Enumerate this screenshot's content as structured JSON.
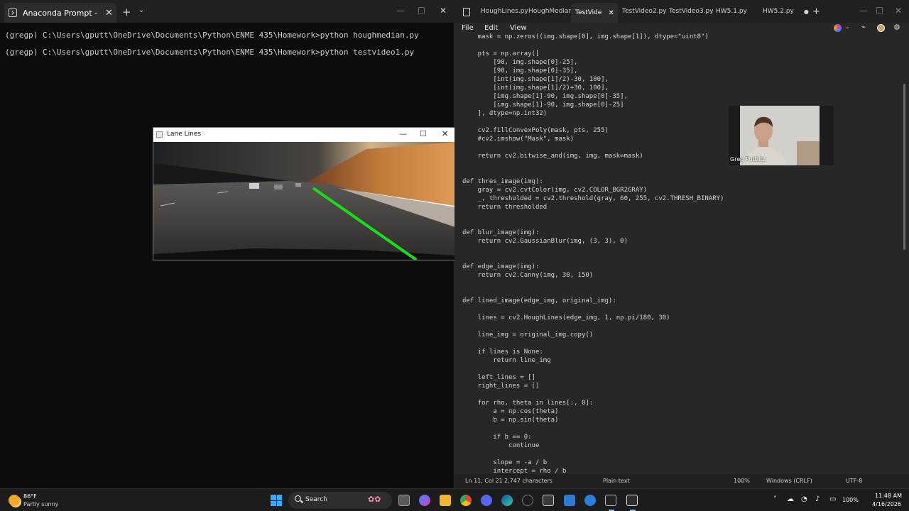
{
  "terminal": {
    "tab_title": "Anaconda Prompt - python t",
    "new_tab": "+",
    "lines": [
      "(gregp) C:\\Users\\gputt\\OneDrive\\Documents\\Python\\ENME 435\\Homework>python houghmedian.py",
      "(gregp) C:\\Users\\gputt\\OneDrive\\Documents\\Python\\ENME 435\\Homework>python testvideo1.py"
    ]
  },
  "lane_window": {
    "title": "Lane Lines"
  },
  "editor": {
    "tabs": [
      "HoughLines.py",
      "HoughMedian.p",
      "TestVide",
      "TestVideo2.py",
      "TestVideo3.py",
      "HW5.1.py",
      "HW5.2.py"
    ],
    "active_tab_index": 2,
    "menu": [
      "File",
      "Edit",
      "View"
    ],
    "code": [
      "    mask = np.zeros((img.shape[0], img.shape[1]), dtype=\"uint8\")",
      "",
      "    pts = np.array([",
      "        [90, img.shape[0]-25],",
      "        [90, img.shape[0]-35],",
      "        [int(img.shape[1]/2)-30, 100],",
      "        [int(img.shape[1]/2)+30, 100],",
      "        [img.shape[1]-90, img.shape[0]-35],",
      "        [img.shape[1]-90, img.shape[0]-25]",
      "    ], dtype=np.int32)",
      "",
      "    cv2.fillConvexPoly(mask, pts, 255)",
      "    #cv2.imshow(\"Mask\", mask)",
      "",
      "    return cv2.bitwise_and(img, img, mask=mask)",
      "",
      "",
      "def thres_image(img):",
      "    gray = cv2.cvtColor(img, cv2.COLOR_BGR2GRAY)",
      "    _, thresholded = cv2.threshold(gray, 60, 255, cv2.THRESH_BINARY)",
      "    return thresholded",
      "",
      "",
      "def blur_image(img):",
      "    return cv2.GaussianBlur(img, (3, 3), 0)",
      "",
      "",
      "def edge_image(img):",
      "    return cv2.Canny(img, 30, 150)",
      "",
      "",
      "def lined_image(edge_img, original_img):",
      "",
      "    lines = cv2.HoughLines(edge_img, 1, np.pi/180, 30)",
      "",
      "    line_img = original_img.copy()",
      "",
      "    if lines is None:",
      "        return line_img",
      "",
      "    left_lines = []",
      "    right_lines = []",
      "",
      "    for rho, theta in lines[:, 0]:",
      "        a = np.cos(theta)",
      "        b = np.sin(theta)",
      "",
      "        if b == 0:",
      "            continue",
      "",
      "        slope = -a / b",
      "        intercept = rho / b"
    ],
    "status": {
      "position": "Ln 11, Col 21",
      "chars": "2,747 characters",
      "format": "Plain text",
      "zoom": "100%",
      "line_ending": "Windows (CRLF)",
      "encoding": "UTF-8"
    }
  },
  "webcam": {
    "name": "Greg Puttlitz"
  },
  "taskbar": {
    "weather_temp": "86°F",
    "weather_desc": "Partly sunny",
    "search_label": "Search",
    "battery": "100%",
    "time": "11:48 AM",
    "date": "4/16/2026"
  }
}
